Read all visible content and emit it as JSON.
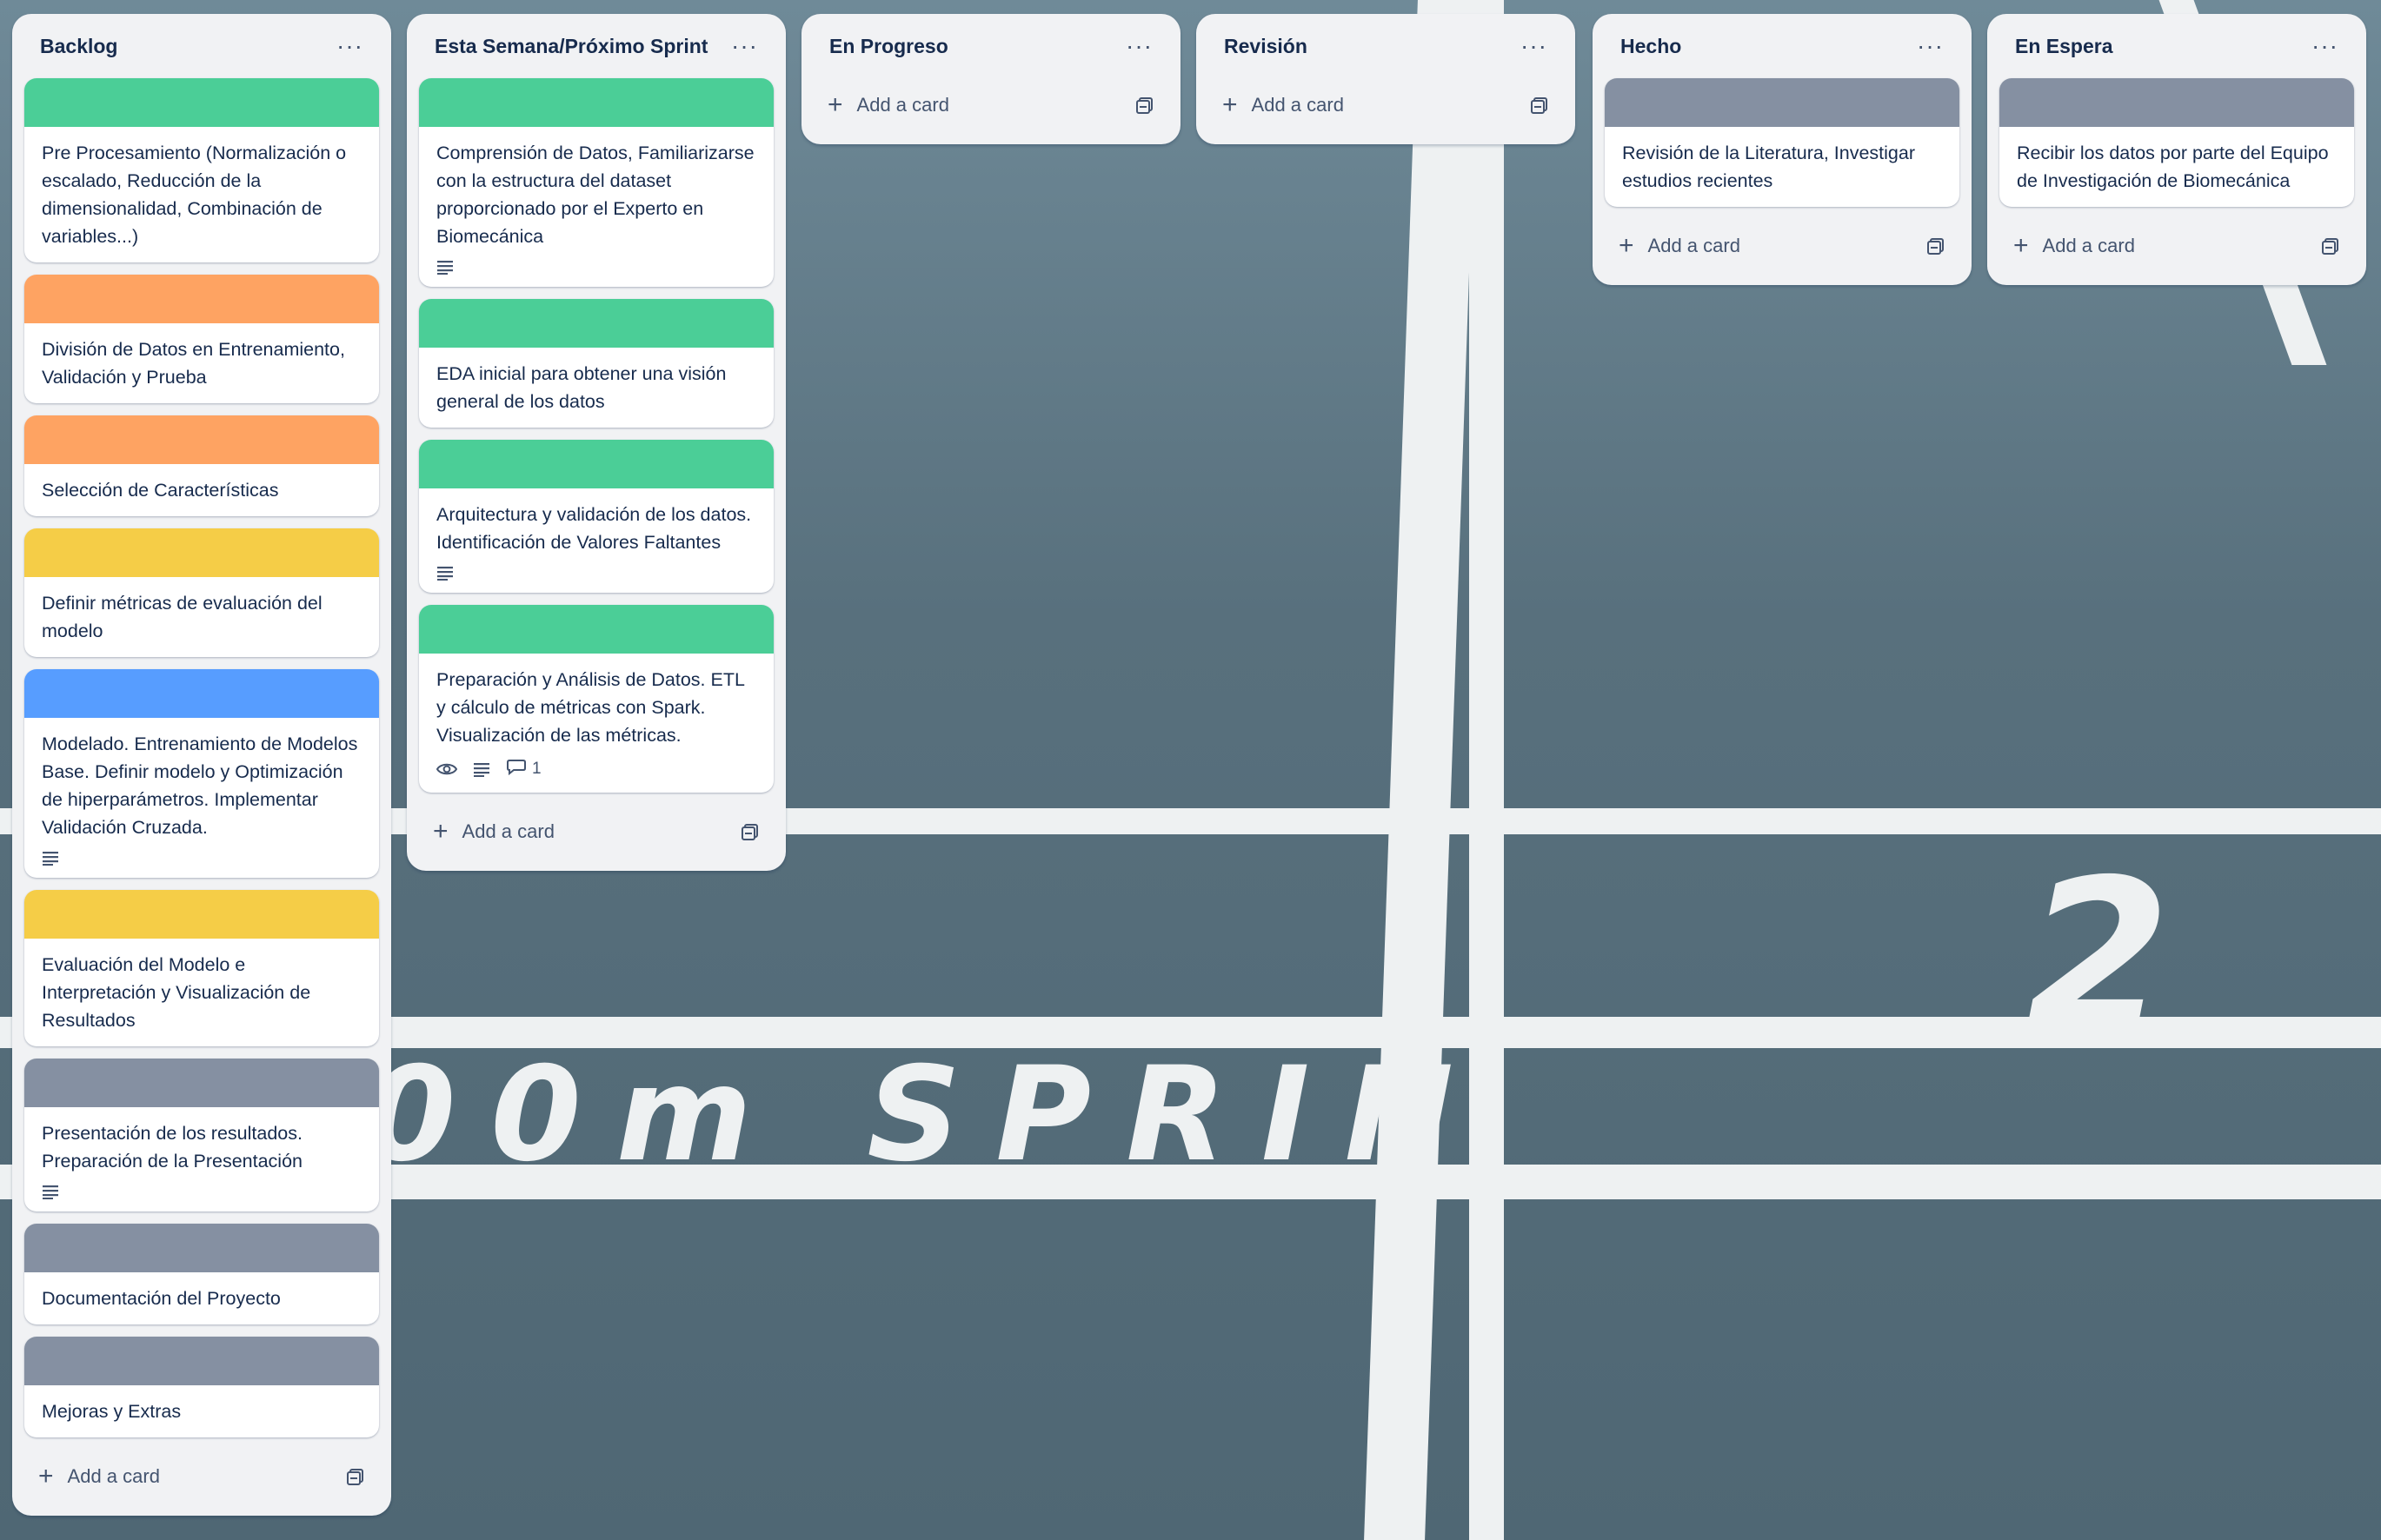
{
  "background": {
    "words": "00m SPRIN",
    "number": "2"
  },
  "colors": {
    "green": "#4bce97",
    "orange": "#fea362",
    "yellow": "#f5cd47",
    "blue": "#579dff",
    "gray": "#8590a2"
  },
  "lists": [
    {
      "title": "Backlog",
      "menu_icon": "ellipsis-icon",
      "cards": [
        {
          "title": "Pre Procesamiento (Normalización o escalado, Reducción de la dimensionalidad, Combinación de variables...)",
          "cover": "#4bce97"
        },
        {
          "title": "División de Datos en Entrenamiento, Validación y Prueba",
          "cover": "#fea362"
        },
        {
          "title": "Selección de Características",
          "cover": "#fea362"
        },
        {
          "title": "Definir métricas de evaluación del modelo",
          "cover": "#f5cd47"
        },
        {
          "title": "Modelado. Entrenamiento de Modelos Base. Definir modelo y Optimización de hiperparámetros. Implementar Validación Cruzada.",
          "cover": "#579dff",
          "description": true
        },
        {
          "title": "Evaluación del Modelo e Interpretación y Visualización de Resultados",
          "cover": "#f5cd47"
        },
        {
          "title": "Presentación de los resultados. Preparación de la Presentación",
          "cover": "#8590a2",
          "description": true
        },
        {
          "title": "Documentación del Proyecto",
          "cover": "#8590a2"
        },
        {
          "title": "Mejoras y Extras",
          "cover": "#8590a2"
        }
      ],
      "add_label": "Add a card"
    },
    {
      "title": "Esta Semana/Próximo Sprint",
      "menu_icon": "ellipsis-icon",
      "cards": [
        {
          "title": "Comprensión de Datos, Familiarizarse con la estructura del dataset proporcionado por el Experto en Biomecánica",
          "cover": "#4bce97",
          "description": true
        },
        {
          "title": "EDA inicial para obtener una visión general de los datos",
          "cover": "#4bce97"
        },
        {
          "title": "Arquitectura y validación de los datos. Identificación de Valores Faltantes",
          "cover": "#4bce97",
          "description": true
        },
        {
          "title": "Preparación y Análisis de Datos. ETL y cálculo de métricas con Spark. Visualización de las métricas.",
          "cover": "#4bce97",
          "watching": true,
          "description": true,
          "comments": "1"
        }
      ],
      "add_label": "Add a card"
    },
    {
      "title": "En Progreso",
      "menu_icon": "ellipsis-icon",
      "cards": [],
      "add_label": "Add a card"
    },
    {
      "title": "Revisión",
      "menu_icon": "ellipsis-icon",
      "cards": [],
      "add_label": "Add a card"
    },
    {
      "title": "Hecho",
      "menu_icon": "ellipsis-icon",
      "cards": [
        {
          "title": "Revisión de la Literatura, Investigar estudios recientes",
          "cover": "#8590a2"
        }
      ],
      "add_label": "Add a card"
    },
    {
      "title": "En Espera",
      "menu_icon": "ellipsis-icon",
      "cards": [
        {
          "title": "Recibir los datos por parte del Equipo de Investigación de Biomecánica",
          "cover": "#8590a2"
        }
      ],
      "add_label": "Add a card"
    }
  ]
}
